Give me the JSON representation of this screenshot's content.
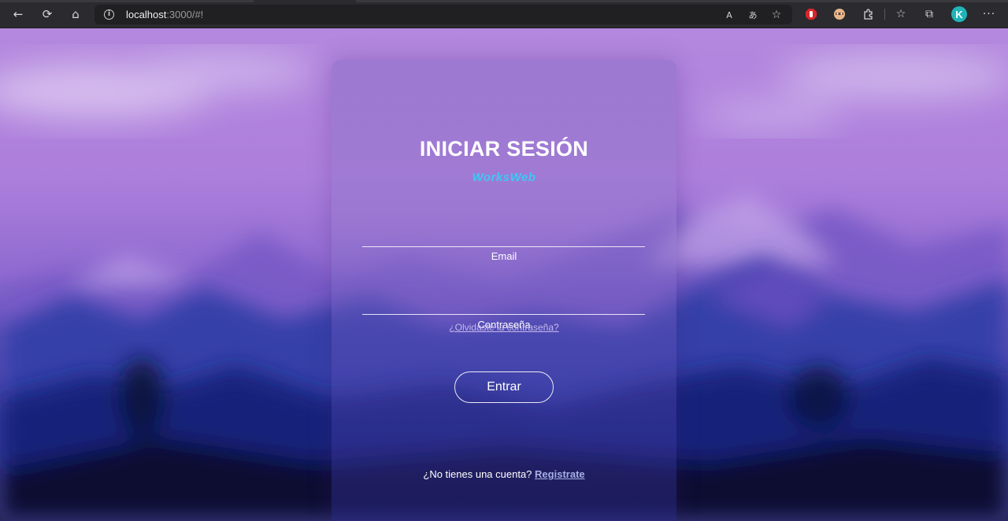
{
  "browser": {
    "url_host": "localhost",
    "url_path": ":3000/#!",
    "nav_icons": {
      "back": "←",
      "refresh": "⟳",
      "home": "⌂"
    },
    "address_icons": {
      "read_aloud": "A",
      "translate": "あ",
      "favorite_add": "☆"
    },
    "toolbar_icons": {
      "favorites": "☆",
      "collections": "⧉",
      "more": "···",
      "extensions": "⚙"
    },
    "profile_initial": "K"
  },
  "login": {
    "title": "INICIAR SESIÓN",
    "brand": "WorksWeb",
    "email_label": "Email",
    "password_label": "Contraseña",
    "forgot_link": "¿Olvidaste la contraseña?",
    "submit_label": "Entrar",
    "signup_prompt": "¿No tienes una cuenta?",
    "signup_link": "Registrate"
  },
  "colors": {
    "brand": "#3ec8f5",
    "link": "#c8b8ee",
    "signup_link": "#a7b0e6",
    "sky": "#b488de",
    "mountains": "#1a2a8a"
  }
}
